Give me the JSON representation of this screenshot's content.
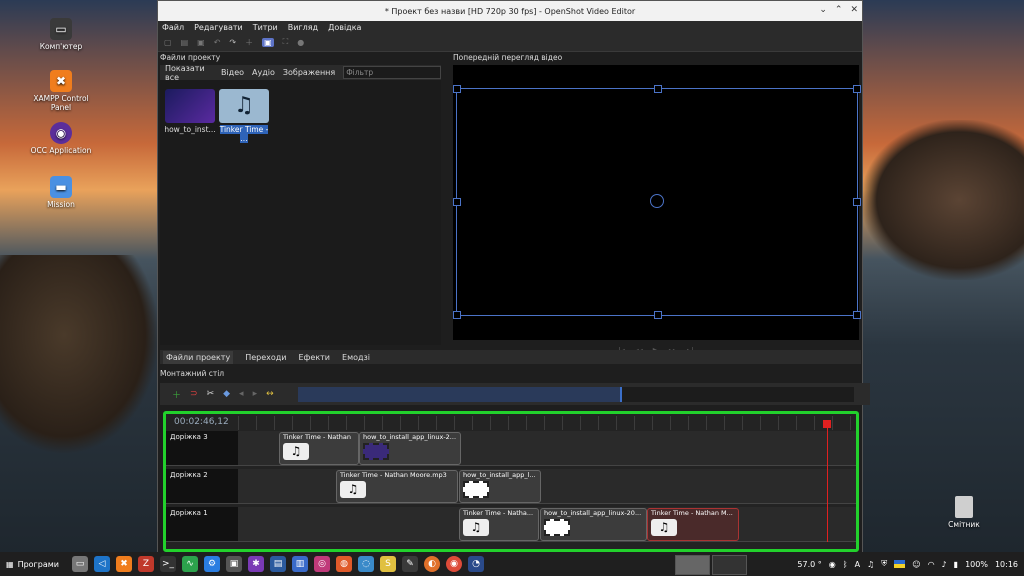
{
  "desktop": {
    "icons": [
      {
        "label": "Комп'ютер",
        "icon": "computer-icon"
      },
      {
        "label": "XAMPP Control Panel",
        "icon": "xampp-icon"
      },
      {
        "label": "OCC Application",
        "icon": "app-icon"
      },
      {
        "label": "Mission",
        "icon": "folder-icon"
      }
    ],
    "trash_label": "Смітник"
  },
  "window": {
    "title": "* Проект без назви [HD 720p 30 fps] - OpenShot Video Editor",
    "menu": [
      "Файл",
      "Редагувати",
      "Титри",
      "Вигляд",
      "Довідка"
    ]
  },
  "files_panel": {
    "title": "Файли проекту",
    "tabs": [
      "Показати все",
      "Відео",
      "Аудіо",
      "Зображення"
    ],
    "filter_placeholder": "Фільтр",
    "files": [
      {
        "name": "how_to_inst..."
      },
      {
        "name": "Tinker Time - ..."
      }
    ]
  },
  "preview_panel": {
    "title": "Попередній перегляд відео"
  },
  "bottom_tabs": [
    "Файли проекту",
    "Переходи",
    "Ефекти",
    "Емодзі"
  ],
  "timeline": {
    "title": "Монтажний стіл",
    "timecode": "00:02:46,12",
    "tracks": [
      {
        "name": "Доріжка 3",
        "clips": [
          {
            "label": "Tinker Time - Nathan",
            "type": "audio"
          },
          {
            "label": "how_to_install_app_linux-2...",
            "type": "video"
          }
        ]
      },
      {
        "name": "Доріжка 2",
        "clips": [
          {
            "label": "Tinker Time - Nathan Moore.mp3",
            "type": "audio"
          },
          {
            "label": "how_to_install_app_l...",
            "type": "video"
          }
        ]
      },
      {
        "name": "Доріжка 1",
        "clips": [
          {
            "label": "Tinker Time - Natha...",
            "type": "audio"
          },
          {
            "label": "how_to_install_app_linux-20...",
            "type": "video"
          },
          {
            "label": "Tinker Time - Nathan M...",
            "type": "audio-selected"
          }
        ]
      }
    ]
  },
  "taskbar": {
    "start_label": "Програми",
    "temperature": "57.0 °",
    "battery": "100%",
    "clock": "10:16"
  }
}
